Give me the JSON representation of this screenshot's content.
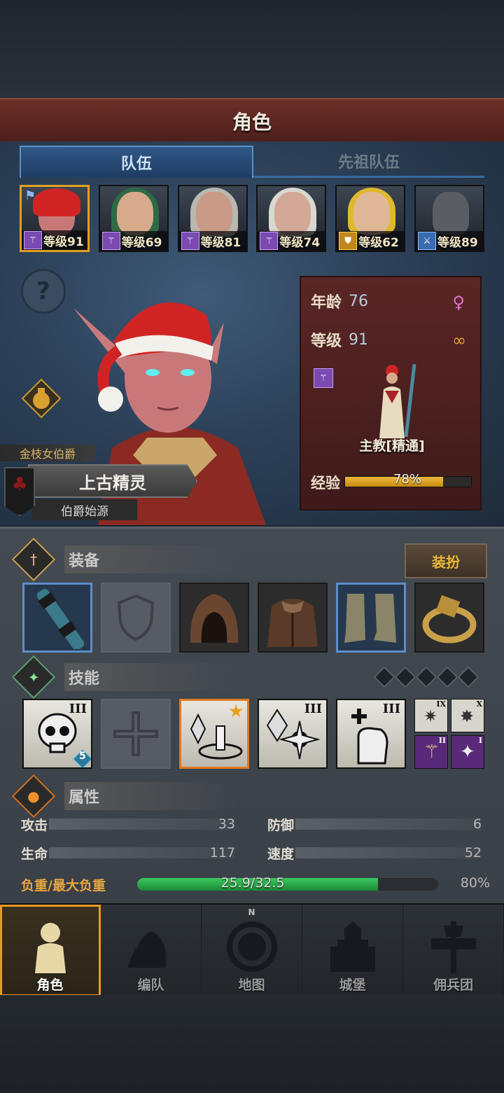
{
  "header": {
    "title": "角色"
  },
  "tabs": [
    {
      "label": "队伍",
      "active": true
    },
    {
      "label": "先祖队伍",
      "active": false
    }
  ],
  "party": [
    {
      "level_text": "等级91",
      "class_icon": "staff-icon",
      "hair": "#d02424",
      "skin": "#c9787a",
      "selected": true
    },
    {
      "level_text": "等级69",
      "class_icon": "staff-icon",
      "hair": "#2e6a46",
      "skin": "#d8aa8c",
      "selected": false
    },
    {
      "level_text": "等级81",
      "class_icon": "staff-icon",
      "hair": "#b8b8b0",
      "skin": "#c99a86",
      "selected": false
    },
    {
      "level_text": "等级74",
      "class_icon": "staff-icon",
      "hair": "#d8d8d0",
      "skin": "#d2a896",
      "selected": false
    },
    {
      "level_text": "等级62",
      "class_icon": "shield-icon",
      "hair": "#e0b830",
      "skin": "#deb896",
      "selected": false
    },
    {
      "level_text": "等级89",
      "class_icon": "sword-icon",
      "hair": "#7a7e82",
      "skin": "#5a5e62",
      "selected": false
    }
  ],
  "character": {
    "title": "金枝女伯爵",
    "race": "上古精灵",
    "origin": "伯爵始源",
    "age_label": "年龄",
    "age": "76",
    "level_label": "等级",
    "level": "91",
    "class_name": "主教[精通]",
    "exp_label": "经验",
    "exp_text": "78%",
    "exp_fraction": 0.78
  },
  "equipment": {
    "title": "装备",
    "dress_button": "装扮",
    "slots": [
      "staff",
      "empty-shield",
      "hood",
      "robe",
      "boots",
      "ring"
    ]
  },
  "skills": {
    "title": "技能",
    "items": [
      {
        "numeral": "III",
        "badge": "5"
      },
      {
        "numeral": ""
      },
      {
        "numeral": "",
        "starred": true
      },
      {
        "numeral": "III"
      },
      {
        "numeral": "III"
      }
    ],
    "mini": [
      "IX",
      "X",
      "II",
      "I"
    ]
  },
  "attributes": {
    "title": "属性",
    "attack_label": "攻击",
    "attack": "33",
    "defense_label": "防御",
    "defense": "6",
    "hp_label": "生命",
    "hp": "117",
    "speed_label": "速度",
    "speed": "52",
    "load_label": "负重/最大负重",
    "load_text": "25.9/32.5",
    "load_pct": "80%",
    "load_fraction": 0.8
  },
  "nav": [
    {
      "label": "角色",
      "active": true
    },
    {
      "label": "编队",
      "active": false
    },
    {
      "label": "地图",
      "active": false,
      "compass": "N"
    },
    {
      "label": "城堡",
      "active": false
    },
    {
      "label": "佣兵团",
      "active": false
    }
  ],
  "colors": {
    "accent_gold": "#e89a20",
    "tab_blue": "#5a90c8",
    "exp_gold": "#f0b840",
    "load_green": "#3cc860"
  }
}
